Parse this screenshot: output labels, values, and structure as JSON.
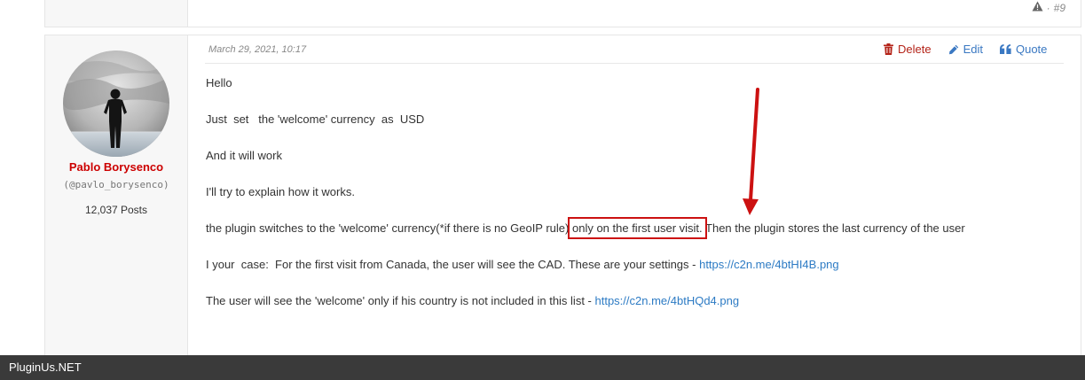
{
  "previous_post": {
    "post_number": "#9"
  },
  "post": {
    "author": {
      "name": "Pablo Borysenco",
      "handle": "(@pavlo_borysenco)",
      "posts": "12,037 Posts"
    },
    "date": "March 29, 2021, 10:17",
    "actions": {
      "delete_label": "Delete",
      "edit_label": "Edit",
      "quote_label": "Quote"
    },
    "paragraphs": {
      "p1": "Hello",
      "p2": "Just  set   the 'welcome' currency  as  USD",
      "p3": "And it will work",
      "p4": "I'll try to explain how it works.",
      "p5_before": "the plugin switches to the 'welcome' currency(*if there is no GeoIP rule) ",
      "p5_highlight": "only on the first user visit.",
      "p5_after": " Then the plugin stores the last currency of the user",
      "p6_text": "I your  case:  For the first visit from Canada, the user will see the CAD. These are your settings - ",
      "p6_link": "https://c2n.me/4btHI4B.png",
      "p7_text": "The user will see the 'welcome' only if his country is not included in this list - ",
      "p7_link": "https://c2n.me/4btHQd4.png"
    }
  },
  "footer": {
    "brand": "PluginUs.NET"
  },
  "colors": {
    "author_name": "#cc0000",
    "delete": "#b42318",
    "link": "#2d7bc4",
    "annotation": "#cc1111",
    "footer_bg": "#3a3a3a"
  }
}
